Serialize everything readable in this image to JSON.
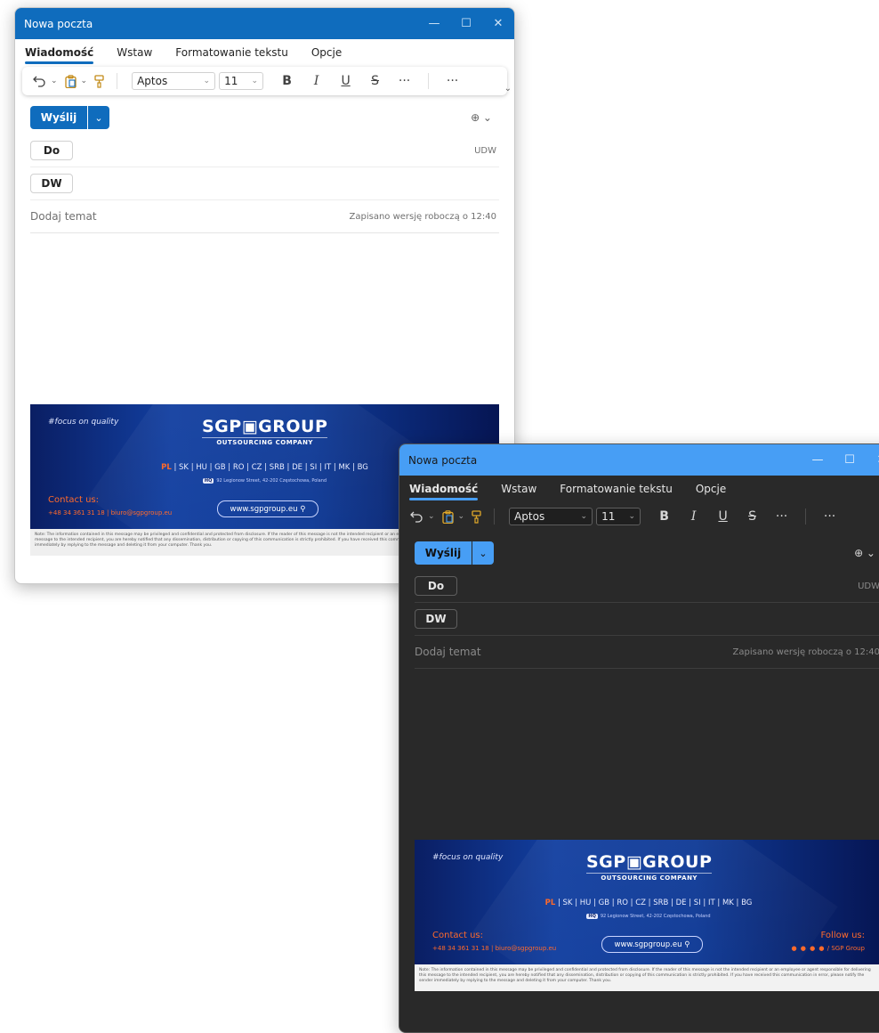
{
  "windows": [
    {
      "theme": "light",
      "title": "Nowa poczta",
      "controls": {
        "minimize": "—",
        "maximize": "☐",
        "close": "✕"
      },
      "tabs": [
        {
          "label": "Wiadomość",
          "active": true
        },
        {
          "label": "Wstaw",
          "active": false
        },
        {
          "label": "Formatowanie tekstu",
          "active": false
        },
        {
          "label": "Opcje",
          "active": false
        }
      ],
      "toolbar": {
        "font": "Aptos",
        "size": "11",
        "bold": "B",
        "italic": "I",
        "underline": "U",
        "strike": "S",
        "more": "···"
      },
      "send": {
        "label": "Wyślij"
      },
      "to_label": "Do",
      "cc_label": "DW",
      "bcc_label": "UDW",
      "subject_placeholder": "Dodaj temat",
      "saved_status": "Zapisano wersję roboczą o 12:40"
    },
    {
      "theme": "dark",
      "title": "Nowa poczta",
      "controls": {
        "minimize": "—",
        "maximize": "☐",
        "close": "✕"
      },
      "tabs": [
        {
          "label": "Wiadomość",
          "active": true
        },
        {
          "label": "Wstaw",
          "active": false
        },
        {
          "label": "Formatowanie tekstu",
          "active": false
        },
        {
          "label": "Opcje",
          "active": false
        }
      ],
      "toolbar": {
        "font": "Aptos",
        "size": "11",
        "bold": "B",
        "italic": "I",
        "underline": "U",
        "strike": "S",
        "more": "···"
      },
      "send": {
        "label": "Wyślij"
      },
      "to_label": "Do",
      "cc_label": "DW",
      "bcc_label": "UDW",
      "subject_placeholder": "Dodaj temat",
      "saved_status": "Zapisano wersję roboczą o 12:40"
    }
  ],
  "signature": {
    "tagline": "#focus on quality",
    "logo_main": "SGP▣GROUP",
    "logo_sub": "OUTSOURCING COMPANY",
    "country_highlight": "PL",
    "countries": " | SK | HU | GB | RO | CZ | SRB | DE | SI | IT | MK | BG",
    "hq_label": "HQ",
    "address": "92 Legionow Street, 42-202 Częstochowa, Poland",
    "contact_heading": "Contact us:",
    "contact_line": "+48 34 361 31 18  |  biuro@sgpgroup.eu",
    "website": "www.sgpgroup.eu",
    "follow_heading": "Follow us:",
    "follow_line": "/ SGP Group",
    "note": "Note: The information contained in this message may be privileged and confidential and protected from disclosure. If the reader of this message is not the intended recipient or an employee or agent responsible for delivering this message to the intended recipient, you are hereby notified that any dissemination, distribution or copying of this communication is strictly prohibited. If you have received this communication in error, please notify the sender immediately by replying to the message and deleting it from your computer. Thank you."
  },
  "colors": {
    "accent_light": "#0f6cbd",
    "accent_dark": "#479ef5",
    "signature_orange": "#ff6a2b",
    "signature_navy": "#0a1e63"
  }
}
